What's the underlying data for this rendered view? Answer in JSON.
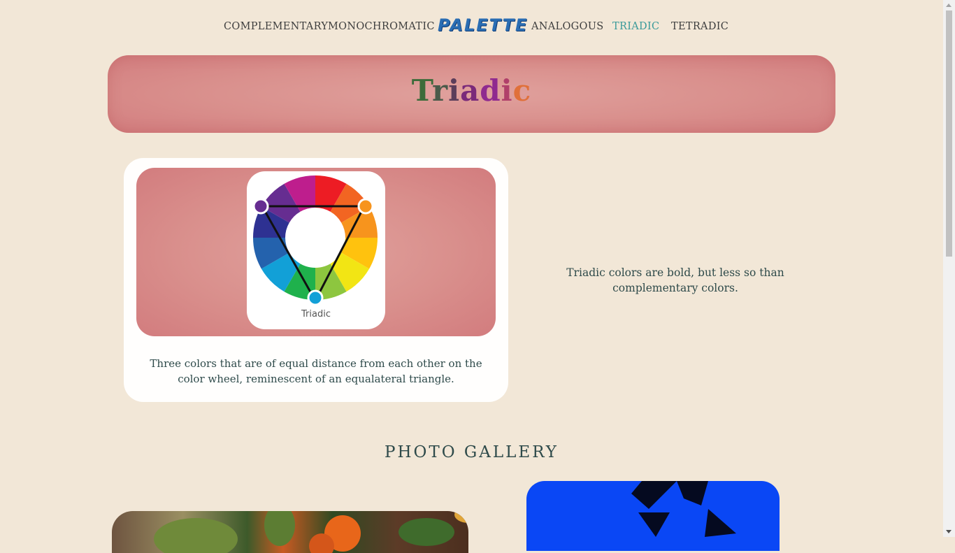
{
  "nav": {
    "items": [
      {
        "label": "COMPLEMENTARY"
      },
      {
        "label": "MONOCHROMATIC"
      },
      {
        "label": "ANALOGOUS"
      },
      {
        "label": "TRIADIC"
      },
      {
        "label": "TETRADIC"
      }
    ],
    "logo": "PALETTE",
    "active": "TRIADIC"
  },
  "hero": {
    "title_letters": [
      {
        "ch": "T",
        "color": "#3d6b3a"
      },
      {
        "ch": "r",
        "color": "#4a5a4a"
      },
      {
        "ch": "i",
        "color": "#5b3d5a"
      },
      {
        "ch": "a",
        "color": "#7a2a7a"
      },
      {
        "ch": "d",
        "color": "#8f2a8f"
      },
      {
        "ch": "i",
        "color": "#b0406a"
      },
      {
        "ch": "c",
        "color": "#e0703a"
      }
    ]
  },
  "card": {
    "wheel_label": "Triadic",
    "description": "Three colors that are of equal distance from each other on the color wheel, reminescent of an equalateral triangle."
  },
  "side_text": "Triadic colors are bold, but less so than complementary colors.",
  "gallery": {
    "title": "PHOTO GALLERY"
  },
  "colors": {
    "background": "#f2e7d7",
    "banner": "#d98f8c",
    "accent": "#3a9a9a",
    "text": "#2e4a4a"
  }
}
